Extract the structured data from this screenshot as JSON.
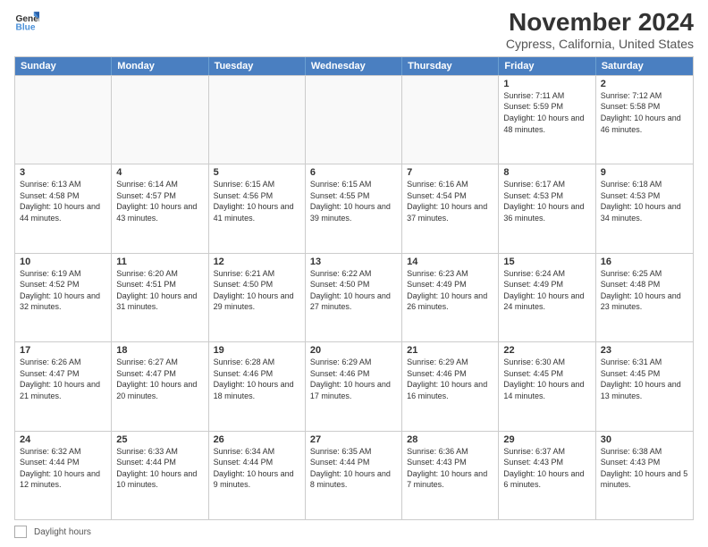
{
  "logo": {
    "line1": "General",
    "line2": "Blue"
  },
  "title": "November 2024",
  "subtitle": "Cypress, California, United States",
  "days_of_week": [
    "Sunday",
    "Monday",
    "Tuesday",
    "Wednesday",
    "Thursday",
    "Friday",
    "Saturday"
  ],
  "weeks": [
    [
      {
        "day": "",
        "empty": true
      },
      {
        "day": "",
        "empty": true
      },
      {
        "day": "",
        "empty": true
      },
      {
        "day": "",
        "empty": true
      },
      {
        "day": "",
        "empty": true
      },
      {
        "day": "1",
        "rise": "Sunrise: 7:11 AM",
        "set": "Sunset: 5:59 PM",
        "daylight": "Daylight: 10 hours and 48 minutes."
      },
      {
        "day": "2",
        "rise": "Sunrise: 7:12 AM",
        "set": "Sunset: 5:58 PM",
        "daylight": "Daylight: 10 hours and 46 minutes."
      }
    ],
    [
      {
        "day": "3",
        "rise": "Sunrise: 6:13 AM",
        "set": "Sunset: 4:58 PM",
        "daylight": "Daylight: 10 hours and 44 minutes."
      },
      {
        "day": "4",
        "rise": "Sunrise: 6:14 AM",
        "set": "Sunset: 4:57 PM",
        "daylight": "Daylight: 10 hours and 43 minutes."
      },
      {
        "day": "5",
        "rise": "Sunrise: 6:15 AM",
        "set": "Sunset: 4:56 PM",
        "daylight": "Daylight: 10 hours and 41 minutes."
      },
      {
        "day": "6",
        "rise": "Sunrise: 6:15 AM",
        "set": "Sunset: 4:55 PM",
        "daylight": "Daylight: 10 hours and 39 minutes."
      },
      {
        "day": "7",
        "rise": "Sunrise: 6:16 AM",
        "set": "Sunset: 4:54 PM",
        "daylight": "Daylight: 10 hours and 37 minutes."
      },
      {
        "day": "8",
        "rise": "Sunrise: 6:17 AM",
        "set": "Sunset: 4:53 PM",
        "daylight": "Daylight: 10 hours and 36 minutes."
      },
      {
        "day": "9",
        "rise": "Sunrise: 6:18 AM",
        "set": "Sunset: 4:53 PM",
        "daylight": "Daylight: 10 hours and 34 minutes."
      }
    ],
    [
      {
        "day": "10",
        "rise": "Sunrise: 6:19 AM",
        "set": "Sunset: 4:52 PM",
        "daylight": "Daylight: 10 hours and 32 minutes."
      },
      {
        "day": "11",
        "rise": "Sunrise: 6:20 AM",
        "set": "Sunset: 4:51 PM",
        "daylight": "Daylight: 10 hours and 31 minutes."
      },
      {
        "day": "12",
        "rise": "Sunrise: 6:21 AM",
        "set": "Sunset: 4:50 PM",
        "daylight": "Daylight: 10 hours and 29 minutes."
      },
      {
        "day": "13",
        "rise": "Sunrise: 6:22 AM",
        "set": "Sunset: 4:50 PM",
        "daylight": "Daylight: 10 hours and 27 minutes."
      },
      {
        "day": "14",
        "rise": "Sunrise: 6:23 AM",
        "set": "Sunset: 4:49 PM",
        "daylight": "Daylight: 10 hours and 26 minutes."
      },
      {
        "day": "15",
        "rise": "Sunrise: 6:24 AM",
        "set": "Sunset: 4:49 PM",
        "daylight": "Daylight: 10 hours and 24 minutes."
      },
      {
        "day": "16",
        "rise": "Sunrise: 6:25 AM",
        "set": "Sunset: 4:48 PM",
        "daylight": "Daylight: 10 hours and 23 minutes."
      }
    ],
    [
      {
        "day": "17",
        "rise": "Sunrise: 6:26 AM",
        "set": "Sunset: 4:47 PM",
        "daylight": "Daylight: 10 hours and 21 minutes."
      },
      {
        "day": "18",
        "rise": "Sunrise: 6:27 AM",
        "set": "Sunset: 4:47 PM",
        "daylight": "Daylight: 10 hours and 20 minutes."
      },
      {
        "day": "19",
        "rise": "Sunrise: 6:28 AM",
        "set": "Sunset: 4:46 PM",
        "daylight": "Daylight: 10 hours and 18 minutes."
      },
      {
        "day": "20",
        "rise": "Sunrise: 6:29 AM",
        "set": "Sunset: 4:46 PM",
        "daylight": "Daylight: 10 hours and 17 minutes."
      },
      {
        "day": "21",
        "rise": "Sunrise: 6:29 AM",
        "set": "Sunset: 4:46 PM",
        "daylight": "Daylight: 10 hours and 16 minutes."
      },
      {
        "day": "22",
        "rise": "Sunrise: 6:30 AM",
        "set": "Sunset: 4:45 PM",
        "daylight": "Daylight: 10 hours and 14 minutes."
      },
      {
        "day": "23",
        "rise": "Sunrise: 6:31 AM",
        "set": "Sunset: 4:45 PM",
        "daylight": "Daylight: 10 hours and 13 minutes."
      }
    ],
    [
      {
        "day": "24",
        "rise": "Sunrise: 6:32 AM",
        "set": "Sunset: 4:44 PM",
        "daylight": "Daylight: 10 hours and 12 minutes."
      },
      {
        "day": "25",
        "rise": "Sunrise: 6:33 AM",
        "set": "Sunset: 4:44 PM",
        "daylight": "Daylight: 10 hours and 10 minutes."
      },
      {
        "day": "26",
        "rise": "Sunrise: 6:34 AM",
        "set": "Sunset: 4:44 PM",
        "daylight": "Daylight: 10 hours and 9 minutes."
      },
      {
        "day": "27",
        "rise": "Sunrise: 6:35 AM",
        "set": "Sunset: 4:44 PM",
        "daylight": "Daylight: 10 hours and 8 minutes."
      },
      {
        "day": "28",
        "rise": "Sunrise: 6:36 AM",
        "set": "Sunset: 4:43 PM",
        "daylight": "Daylight: 10 hours and 7 minutes."
      },
      {
        "day": "29",
        "rise": "Sunrise: 6:37 AM",
        "set": "Sunset: 4:43 PM",
        "daylight": "Daylight: 10 hours and 6 minutes."
      },
      {
        "day": "30",
        "rise": "Sunrise: 6:38 AM",
        "set": "Sunset: 4:43 PM",
        "daylight": "Daylight: 10 hours and 5 minutes."
      }
    ]
  ],
  "legend": {
    "label": "Daylight hours"
  }
}
